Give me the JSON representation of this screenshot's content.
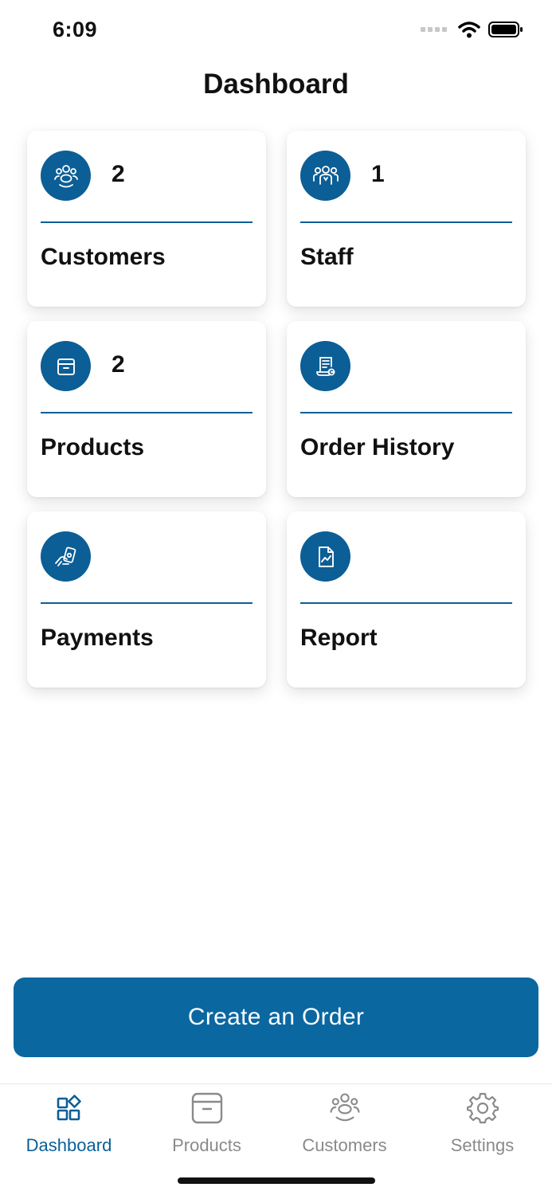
{
  "status_bar": {
    "time": "6:09"
  },
  "header": {
    "title": "Dashboard"
  },
  "cards": [
    {
      "label": "Customers",
      "count": "2",
      "icon": "customers-group-icon"
    },
    {
      "label": "Staff",
      "count": "1",
      "icon": "staff-group-icon"
    },
    {
      "label": "Products",
      "count": "2",
      "icon": "box-icon"
    },
    {
      "label": "Order History",
      "count": "",
      "icon": "receipt-icon"
    },
    {
      "label": "Payments",
      "count": "",
      "icon": "hand-payment-icon"
    },
    {
      "label": "Report",
      "count": "",
      "icon": "report-chart-icon"
    }
  ],
  "create_order": {
    "label": "Create an Order"
  },
  "tab_bar": {
    "items": [
      {
        "label": "Dashboard",
        "icon": "dashboard-icon",
        "active": true
      },
      {
        "label": "Products",
        "icon": "box-icon",
        "active": false
      },
      {
        "label": "Customers",
        "icon": "customers-group-icon",
        "active": false
      },
      {
        "label": "Settings",
        "icon": "gear-icon",
        "active": false
      }
    ]
  },
  "colors": {
    "primary": "#0c5e96",
    "button": "#0a67a0",
    "tab_inactive": "#8a8a8a"
  }
}
